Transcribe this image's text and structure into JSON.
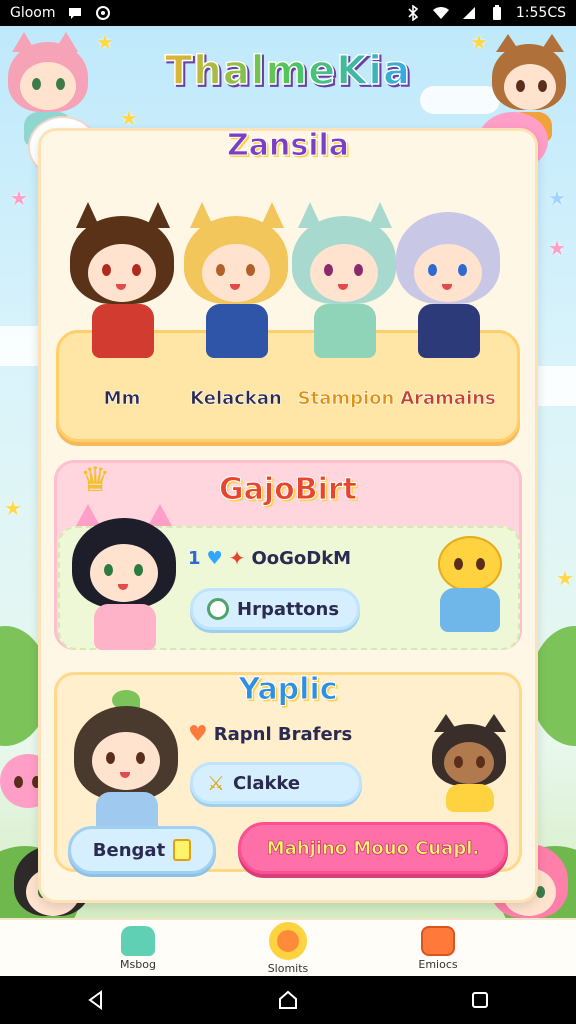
{
  "status_bar": {
    "carrier": "Gloom",
    "time": "1:55CS",
    "icons": [
      "chat-bubble-icon",
      "circle-app-icon",
      "bluetooth-icon",
      "wifi-icon",
      "signal-icon",
      "battery-icon"
    ]
  },
  "app": {
    "title": "ThalmeKia"
  },
  "team_section": {
    "title": "Zansila",
    "characters": [
      {
        "name": "Mm",
        "color": "#d23b2f",
        "hair": "#5a3218"
      },
      {
        "name": "Kelackan",
        "color": "#2f55a8",
        "hair": "#f2c65a"
      },
      {
        "name": "Stampion",
        "color": "#8fd3b8",
        "hair": "#a7d9cf"
      },
      {
        "name": "Aramains",
        "color": "#2d3a7a",
        "hair": "#c8c8e6"
      }
    ]
  },
  "gajo_card": {
    "title": "GajoBirt",
    "row_icons": [
      "number-one-icon",
      "heart-icon",
      "puzzle-icon"
    ],
    "row_text": "OoGoDkM",
    "button_label": "Hrpattons"
  },
  "yaplic_card": {
    "title": "Yaplic",
    "row1_text": "Rapnl Brafers",
    "row2_button_label": "Clakke"
  },
  "actions": {
    "secondary_label": "Bengat",
    "primary_label": "Mahjino Mouo Cuapl."
  },
  "bottom_nav": {
    "items": [
      {
        "label": "Msbog",
        "icon": "frog-icon"
      },
      {
        "label": "Slomits",
        "icon": "donut-icon"
      },
      {
        "label": "Emiocs",
        "icon": "book-icon"
      }
    ]
  },
  "colors": {
    "accent_pink": "#ff6fa8",
    "accent_blue": "#d6efff",
    "panel": "#fff7e6"
  }
}
